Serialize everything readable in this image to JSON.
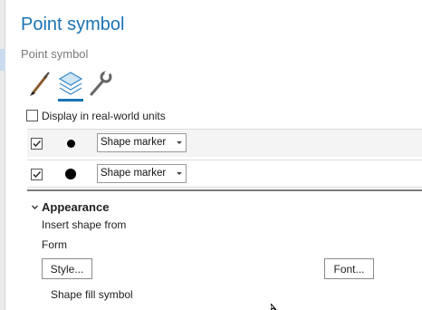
{
  "panel": {
    "title": "Point symbol",
    "subtitle": "Point symbol"
  },
  "tabs": [
    {
      "name": "symbol",
      "icon": "paintbrush-icon",
      "active": false
    },
    {
      "name": "layers",
      "icon": "layers-icon",
      "active": true
    },
    {
      "name": "structure",
      "icon": "wrench-icon",
      "active": false
    }
  ],
  "realworld": {
    "label": "Display in real-world units",
    "checked": false
  },
  "layers": [
    {
      "enabled": true,
      "marker": "Shape marker"
    },
    {
      "enabled": true,
      "marker": "Shape marker"
    }
  ],
  "appearance": {
    "heading": "Appearance",
    "insert_label": "Insert shape from",
    "form_label": "Form",
    "style_button": "Style...",
    "font_button": "Font...",
    "fill_label": "Shape fill symbol"
  },
  "colors": {
    "accent": "#1a73b4",
    "title": "#1a73b4"
  }
}
